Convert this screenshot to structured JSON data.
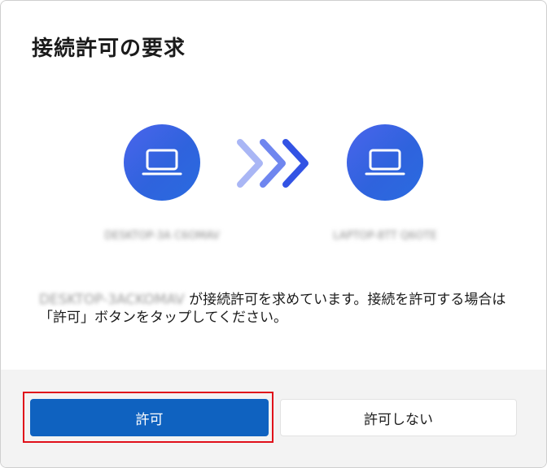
{
  "dialog": {
    "title": "接続許可の要求",
    "source_device": {
      "name": "DESKTOP-3A C6OMAV",
      "icon": "laptop-icon"
    },
    "target_device": {
      "name": "LAPTOP-8TT Q6OTE",
      "icon": "laptop-icon"
    },
    "transfer_icon": "chevrons-right-icon",
    "message": {
      "requester": "DESKTOP-3ACKOMAV",
      "text": "が接続許可を求めています。接続を許可する場合は「許可」ボタンをタップしてください。"
    },
    "buttons": {
      "allow": "許可",
      "deny": "許可しない"
    }
  },
  "colors": {
    "accent": "#0f62c0",
    "device_circle": "#3a63e6",
    "highlight": "#e0101a",
    "footer_bg": "#f3f3f3"
  }
}
